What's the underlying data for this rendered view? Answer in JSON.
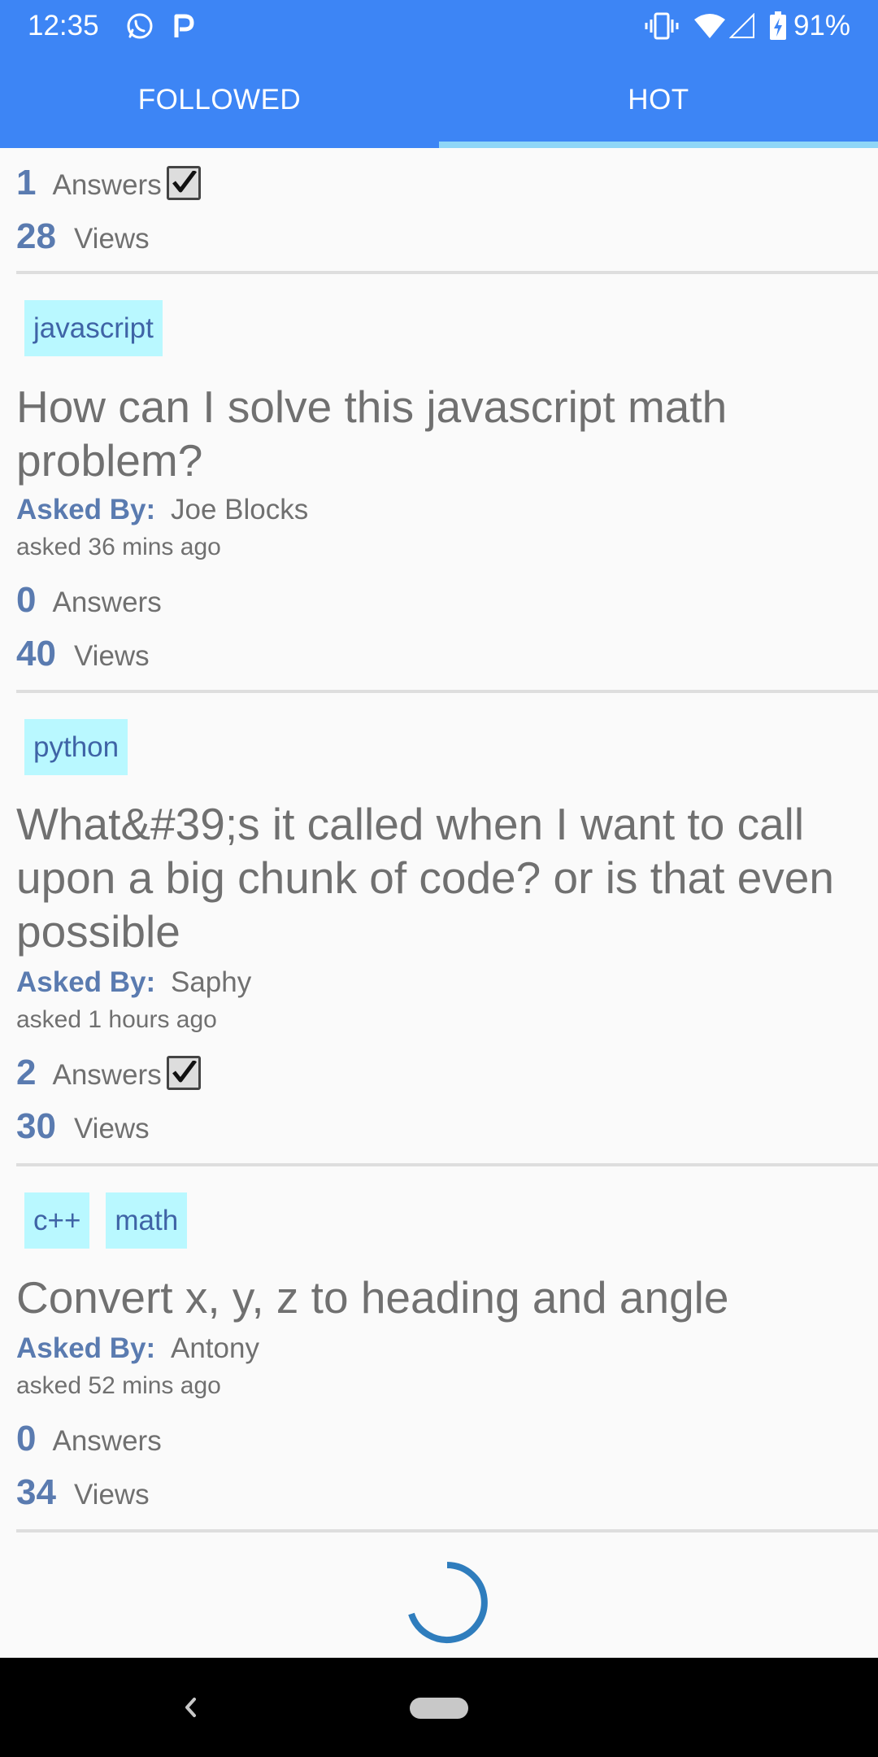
{
  "status_bar": {
    "time": "12:35",
    "battery": "91%",
    "icons": [
      "whatsapp-icon",
      "parking-icon",
      "vibrate-icon",
      "wifi-icon",
      "signal-icon",
      "battery-charging-icon"
    ]
  },
  "tabs": [
    {
      "label": "FOLLOWED",
      "active": false
    },
    {
      "label": "HOT",
      "active": true
    }
  ],
  "colors": {
    "header": "#3d85f5",
    "tab_indicator": "#8fd6f7",
    "tag_background": "#b9f8ff",
    "accent_text": "#5a7bb0",
    "spinner": "#2f7dbd"
  },
  "questions": [
    {
      "answers": "1",
      "answers_label": "Answers",
      "accepted": true,
      "views": "28",
      "views_label": "Views"
    },
    {
      "tags": [
        "javascript"
      ],
      "title": "How can I solve this javascript math problem?",
      "asked_by_label": "Asked By:",
      "author": "Joe Blocks",
      "asked_time": "asked 36 mins ago",
      "answers": "0",
      "answers_label": "Answers",
      "accepted": false,
      "views": "40",
      "views_label": "Views"
    },
    {
      "tags": [
        "python"
      ],
      "title": "What&#39;s it called when I want to call upon a big chunk of code? or is that even possible",
      "asked_by_label": "Asked By:",
      "author": "Saphy",
      "asked_time": "asked 1 hours ago",
      "answers": "2",
      "answers_label": "Answers",
      "accepted": true,
      "views": "30",
      "views_label": "Views"
    },
    {
      "tags": [
        "c++",
        "math"
      ],
      "title": "Convert x, y, z to heading and angle",
      "asked_by_label": "Asked By:",
      "author": "Antony",
      "asked_time": "asked 52 mins ago",
      "answers": "0",
      "answers_label": "Answers",
      "accepted": false,
      "views": "34",
      "views_label": "Views"
    }
  ],
  "navigation": {
    "icons": [
      "back-icon",
      "home-pill-icon"
    ]
  }
}
